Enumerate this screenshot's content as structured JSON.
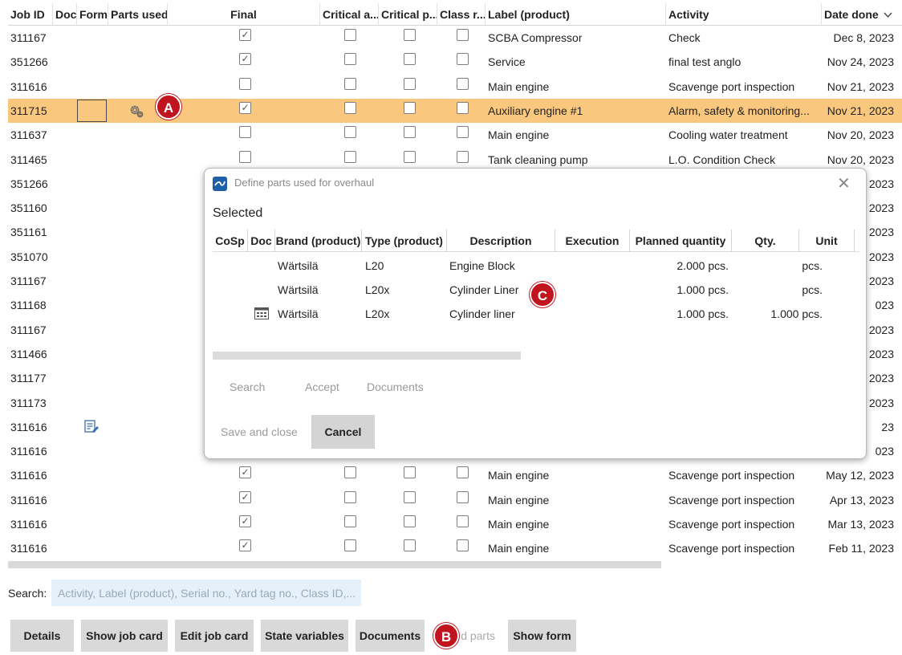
{
  "grid": {
    "columns": [
      {
        "label": "Job ID"
      },
      {
        "label": "Doc"
      },
      {
        "label": "Form"
      },
      {
        "label": "Parts used"
      },
      {
        "label": "Final"
      },
      {
        "label": "Critical a..."
      },
      {
        "label": "Critical p..."
      },
      {
        "label": "Class r..."
      },
      {
        "label": "Label (product)"
      },
      {
        "label": "Activity"
      },
      {
        "label": "Date done"
      }
    ],
    "sort_icon": "chevron-down-icon",
    "selected_row_color": "#f9c77e",
    "rows": [
      {
        "job_id": "311167",
        "final": true,
        "critical_a": false,
        "critical_p": false,
        "class_r": false,
        "label": "SCBA Compressor",
        "activity": "Check",
        "date": "Dec 8, 2023"
      },
      {
        "job_id": "351266",
        "final": true,
        "critical_a": false,
        "critical_p": false,
        "class_r": false,
        "label": "Service",
        "activity": "final test anglo",
        "date": "Nov 24, 2023"
      },
      {
        "job_id": "311616",
        "final": false,
        "critical_a": false,
        "critical_p": false,
        "class_r": false,
        "label": "Main engine",
        "activity": "Scavenge port inspection",
        "date": "Nov 21, 2023"
      },
      {
        "job_id": "311715",
        "final": true,
        "critical_a": false,
        "critical_p": false,
        "class_r": false,
        "label": "Auxiliary engine #1",
        "activity": "Alarm, safety & monitoring...",
        "date": "Nov 21, 2023",
        "selected": true
      },
      {
        "job_id": "311637",
        "final": false,
        "critical_a": false,
        "critical_p": false,
        "class_r": false,
        "label": "Main engine",
        "activity": "Cooling water treatment",
        "date": "Nov 20, 2023"
      },
      {
        "job_id": "311465",
        "final": false,
        "critical_a": false,
        "critical_p": false,
        "class_r": false,
        "label": "Tank cleaning pump",
        "activity": "L.O. Condition Check",
        "date": "Nov 20, 2023"
      },
      {
        "job_id": "351266",
        "date": "2023"
      },
      {
        "job_id": "351160",
        "date": "2023"
      },
      {
        "job_id": "351161",
        "date": "2023"
      },
      {
        "job_id": "351070",
        "date": "2023"
      },
      {
        "job_id": "311167",
        "date": "2023"
      },
      {
        "job_id": "311168",
        "date": "023"
      },
      {
        "job_id": "311167",
        "date": "2023"
      },
      {
        "job_id": "311466",
        "date": "2023"
      },
      {
        "job_id": "311177",
        "date": "2023"
      },
      {
        "job_id": "311173",
        "date": "2023"
      },
      {
        "job_id": "311616",
        "date": "23",
        "form_icon": "form-edit-icon"
      },
      {
        "job_id": "311616",
        "date": "023"
      },
      {
        "job_id": "311616",
        "final": true,
        "critical_a": false,
        "critical_p": false,
        "class_r": false,
        "label": "Main engine",
        "activity": "Scavenge port inspection",
        "date": "May 12, 2023"
      },
      {
        "job_id": "311616",
        "final": true,
        "critical_a": false,
        "critical_p": false,
        "class_r": false,
        "label": "Main engine",
        "activity": "Scavenge port inspection",
        "date": "Apr 13, 2023"
      },
      {
        "job_id": "311616",
        "final": true,
        "critical_a": false,
        "critical_p": false,
        "class_r": false,
        "label": "Main engine",
        "activity": "Scavenge port inspection",
        "date": "Mar 13, 2023"
      },
      {
        "job_id": "311616",
        "final": true,
        "critical_a": false,
        "critical_p": false,
        "class_r": false,
        "label": "Main engine",
        "activity": "Scavenge port inspection",
        "date": "Feb 11, 2023"
      }
    ]
  },
  "search": {
    "label": "Search:",
    "placeholder": "Activity, Label (product), Serial no., Yard tag no., Class ID,..."
  },
  "buttons": {
    "details": "Details",
    "show_job_card": "Show job card",
    "edit_job_card": "Edit job card",
    "state_variables": "State variables",
    "documents": "Documents",
    "used_parts_partial": "d parts",
    "show_form": "Show form"
  },
  "callouts": {
    "a": "A",
    "b": "B",
    "c": "C",
    "color": "#c0151f"
  },
  "dialog": {
    "title": "Define parts used for overhaul",
    "close_glyph": "✕",
    "section_title": "Selected",
    "columns": [
      "CoSp",
      "Doc",
      "Brand (product)",
      "Type (product)",
      "Description",
      "Execution",
      "Planned quantity",
      "Qty.",
      "Unit"
    ],
    "rows": [
      {
        "brand": "Wärtsilä",
        "type": "L20",
        "description": "Engine Block",
        "planned": "2.000 pcs.",
        "qty": "",
        "unit": "pcs.",
        "doc_icon": ""
      },
      {
        "brand": "Wärtsilä",
        "type": "L20x",
        "description": "Cylinder Liner",
        "planned": "1.000 pcs.",
        "qty": "",
        "unit": "pcs.",
        "doc_icon": ""
      },
      {
        "brand": "Wärtsilä",
        "type": "L20x",
        "description": "Cylinder liner",
        "planned": "1.000 pcs.",
        "qty": "1.000 pcs.",
        "unit": "",
        "doc_icon": "grid-icon"
      }
    ],
    "actions": {
      "search": "Search",
      "accept": "Accept",
      "documents": "Documents"
    },
    "save_close": "Save and close",
    "cancel": "Cancel"
  }
}
